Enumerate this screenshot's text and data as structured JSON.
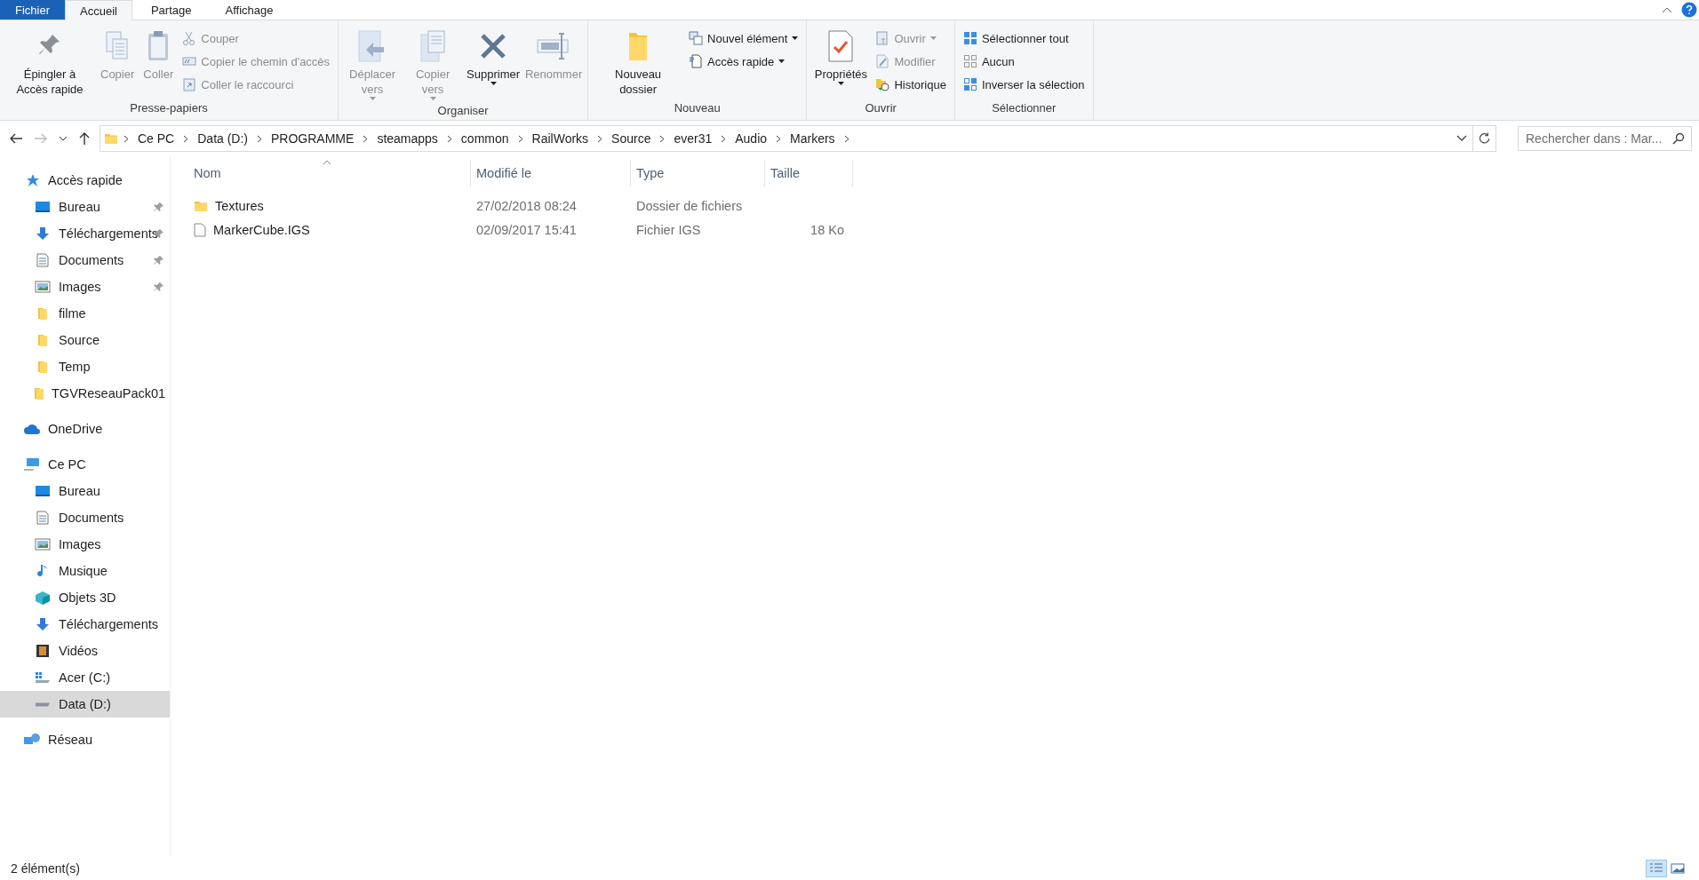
{
  "tabs": [
    {
      "label": "Fichier",
      "kind": "file",
      "selected": false
    },
    {
      "label": "Accueil",
      "kind": "tab",
      "selected": true
    },
    {
      "label": "Partage",
      "kind": "tab",
      "selected": false
    },
    {
      "label": "Affichage",
      "kind": "tab",
      "selected": false
    }
  ],
  "ribbon": [
    {
      "label": "Presse-papiers",
      "items": [
        {
          "kind": "large",
          "label": "Épingler à Accès rapide",
          "disabled": false,
          "menu": false
        },
        {
          "kind": "large",
          "label": "Copier",
          "disabled": true,
          "menu": false
        },
        {
          "kind": "large",
          "label": "Coller",
          "disabled": true,
          "menu": false
        },
        {
          "kind": "stack",
          "items": [
            {
              "label": "Couper",
              "disabled": true,
              "menu": false
            },
            {
              "label": "Copier le chemin d'accès",
              "disabled": true,
              "menu": false
            },
            {
              "label": "Coller le raccourci",
              "disabled": true,
              "menu": false
            }
          ]
        }
      ]
    },
    {
      "label": "Organiser",
      "items": [
        {
          "kind": "large",
          "label": "Déplacer vers",
          "disabled": true,
          "menu": true
        },
        {
          "kind": "large",
          "label": "Copier vers",
          "disabled": true,
          "menu": true
        },
        {
          "kind": "large",
          "label": "Supprimer",
          "disabled": false,
          "menu": true
        },
        {
          "kind": "large",
          "label": "Renommer",
          "disabled": true,
          "menu": false
        }
      ]
    },
    {
      "label": "Nouveau",
      "items": [
        {
          "kind": "large",
          "label": "Nouveau dossier",
          "disabled": false,
          "menu": false
        },
        {
          "kind": "stack",
          "items": [
            {
              "label": "Nouvel élément",
              "disabled": false,
              "menu": true
            },
            {
              "label": "Accès rapide",
              "disabled": false,
              "menu": true
            }
          ]
        }
      ]
    },
    {
      "label": "Ouvrir",
      "items": [
        {
          "kind": "large",
          "label": "Propriétés",
          "disabled": false,
          "menu": true
        },
        {
          "kind": "stack",
          "items": [
            {
              "label": "Ouvrir",
              "disabled": true,
              "menu": true
            },
            {
              "label": "Modifier",
              "disabled": true,
              "menu": false
            },
            {
              "label": "Historique",
              "disabled": false,
              "menu": false
            }
          ]
        }
      ]
    },
    {
      "label": "Sélectionner",
      "items": [
        {
          "kind": "stack",
          "items": [
            {
              "label": "Sélectionner tout",
              "disabled": false,
              "menu": false
            },
            {
              "label": "Aucun",
              "disabled": false,
              "menu": false
            },
            {
              "label": "Inverser la sélection",
              "disabled": false,
              "menu": false
            }
          ]
        }
      ]
    }
  ],
  "address": {
    "crumbs": [
      "Ce PC",
      "Data (D:)",
      "PROGRAMME",
      "steamapps",
      "common",
      "RailWorks",
      "Source",
      "ever31",
      "Audio",
      "Markers"
    ]
  },
  "search": {
    "placeholder": "Rechercher dans : Mar..."
  },
  "sidebar": [
    {
      "label": "Accès rapide",
      "selected": false,
      "children": [
        {
          "label": "Bureau",
          "pinned": true,
          "selected": false
        },
        {
          "label": "Téléchargements",
          "pinned": true,
          "selected": false
        },
        {
          "label": "Documents",
          "pinned": true,
          "selected": false
        },
        {
          "label": "Images",
          "pinned": true,
          "selected": false
        },
        {
          "label": "filme",
          "pinned": false,
          "selected": false
        },
        {
          "label": "Source",
          "pinned": false,
          "selected": false
        },
        {
          "label": "Temp",
          "pinned": false,
          "selected": false
        },
        {
          "label": "TGVReseauPack01",
          "pinned": false,
          "selected": false
        }
      ]
    },
    {
      "label": "OneDrive",
      "selected": false
    },
    {
      "label": "Ce PC",
      "selected": false,
      "children": [
        {
          "label": "Bureau",
          "pinned": false,
          "selected": false
        },
        {
          "label": "Documents",
          "pinned": false,
          "selected": false
        },
        {
          "label": "Images",
          "pinned": false,
          "selected": false
        },
        {
          "label": "Musique",
          "pinned": false,
          "selected": false
        },
        {
          "label": "Objets 3D",
          "pinned": false,
          "selected": false
        },
        {
          "label": "Téléchargements",
          "pinned": false,
          "selected": false
        },
        {
          "label": "Vidéos",
          "pinned": false,
          "selected": false
        },
        {
          "label": "Acer (C:)",
          "pinned": false,
          "selected": false
        },
        {
          "label": "Data (D:)",
          "pinned": false,
          "selected": true
        }
      ]
    },
    {
      "label": "Réseau",
      "selected": false
    }
  ],
  "table": {
    "columns": [
      "Nom",
      "Modifié le",
      "Type",
      "Taille"
    ],
    "rows": [
      {
        "kind": "folder",
        "name": "Textures",
        "modified": "27/02/2018 08:24",
        "type": "Dossier de fichiers",
        "size": ""
      },
      {
        "kind": "file",
        "name": "MarkerCube.IGS",
        "modified": "02/09/2017 15:41",
        "type": "Fichier IGS",
        "size": "18 Ko"
      }
    ]
  },
  "status_bar": {
    "count": "2 élément(s)",
    "views": [
      {
        "selected": true
      },
      {
        "selected": false
      }
    ]
  }
}
